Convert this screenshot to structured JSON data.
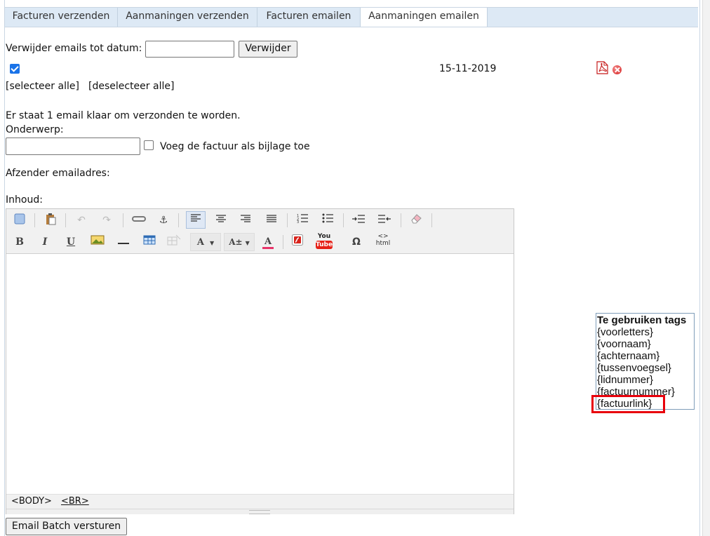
{
  "tabs": [
    {
      "label": "Facturen verzenden",
      "active": false
    },
    {
      "label": "Aanmaningen verzenden",
      "active": false
    },
    {
      "label": "Facturen emailen",
      "active": false
    },
    {
      "label": "Aanmaningen emailen",
      "active": true
    }
  ],
  "delete_section": {
    "label": "Verwijder emails tot datum:",
    "date_value": "",
    "button_label": "Verwijder"
  },
  "email_list": {
    "row": {
      "checked": true,
      "date": "15-11-2019",
      "icons": [
        "pdf-icon",
        "delete-icon"
      ]
    },
    "select_all": "[selecteer alle]",
    "deselect_all": "[deselecteer alle]"
  },
  "form": {
    "ready_text": "Er staat 1 email klaar om verzonden te worden.",
    "subject_label": "Onderwerp:",
    "subject_value": "",
    "attach_label": "Voeg de factuur als bijlage toe",
    "attach_checked": false,
    "sender_label": "Afzender emailadres:",
    "content_label": "Inhoud:"
  },
  "editor": {
    "toolbar1": [
      "new-page-icon",
      "paste-icon",
      "undo-icon",
      "redo-icon",
      "link-icon",
      "anchor-icon",
      "align-left-icon",
      "align-center-icon",
      "align-right-icon",
      "justify-icon",
      "numbered-list-icon",
      "bulleted-list-icon",
      "indent-icon",
      "outdent-icon",
      "eraser-icon"
    ],
    "toolbar2": {
      "bold": "B",
      "italic": "I",
      "underline": "U",
      "font_size": "A",
      "font_size_alt": "A±",
      "font_color": "A",
      "youtube_top": "You",
      "youtube_bottom": "Tube",
      "special_char": "Ω",
      "html_top": "<>",
      "html_bottom": "html"
    },
    "statusbar": {
      "body_tag": "<BODY>",
      "br_tag": "<BR>"
    }
  },
  "tags_box": {
    "title": "Te gebruiken tags",
    "tags": [
      "{voorletters}",
      "{voornaam}",
      "{achternaam}",
      "{tussenvoegsel}",
      "{lidnummer}",
      "{factuurnummer}",
      "{factuurlink}"
    ],
    "highlighted": "{factuurlink}",
    "highlight_color": "#e8000b"
  },
  "send_button": "Email Batch versturen",
  "colors": {
    "tab_bar": "#dde9f5",
    "checkbox_checked": "#1a73e8",
    "youtube_red": "#e62117"
  }
}
